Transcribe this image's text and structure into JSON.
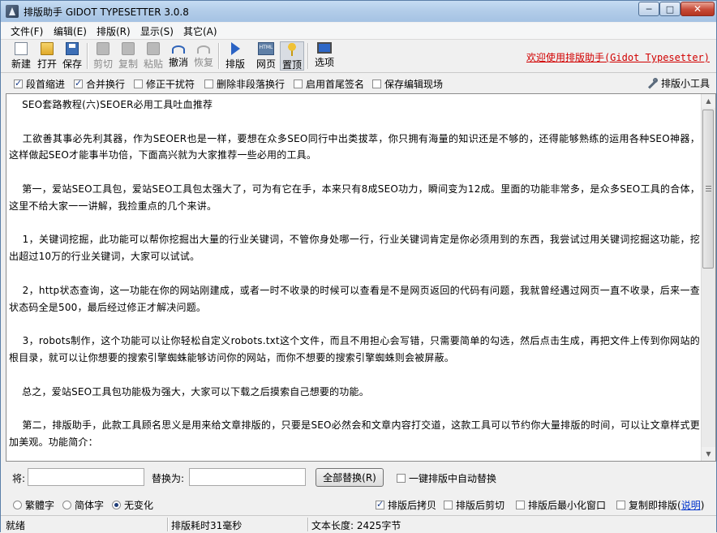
{
  "window": {
    "title": "排版助手 GIDOT TYPESETTER 3.0.8",
    "min_glyph": "─",
    "max_glyph": "□",
    "close_glyph": "✕"
  },
  "menu": [
    {
      "label": "文件(F)"
    },
    {
      "label": "编辑(E)"
    },
    {
      "label": "排版(R)"
    },
    {
      "label": "显示(S)"
    },
    {
      "label": "其它(A)"
    }
  ],
  "toolbar": {
    "new": "新建",
    "open": "打开",
    "save": "保存",
    "cut": "剪切",
    "copy": "复制",
    "paste": "粘贴",
    "undo": "撤消",
    "redo": "恢复",
    "typeset": "排版",
    "webpage": "网页",
    "top": "置顶",
    "options": "选项",
    "welcome": "欢迎使用排版助手(Gidot Typesetter)"
  },
  "options": {
    "indent": {
      "label": "段首缩进",
      "checked": true
    },
    "merge_lines": {
      "label": "合并换行",
      "checked": true
    },
    "fix_interference": {
      "label": "修正干扰符",
      "checked": false
    },
    "delete_nonpara": {
      "label": "删除非段落换行",
      "checked": false
    },
    "head_tail_sign": {
      "label": "启用首尾签名",
      "checked": false
    },
    "save_scene": {
      "label": "保存编辑现场",
      "checked": false
    },
    "tools": "排版小工具"
  },
  "editor": {
    "paragraphs": [
      "    SEO套路教程(六)SEOER必用工具吐血推荐",
      "",
      "    工欲善其事必先利其器，作为SEOER也是一样，要想在众多SEO同行中出类拔萃，你只拥有海量的知识还是不够的，还得能够熟练的运用各种SEO神器，这样做起SEO才能事半功倍，下面高兴就为大家推荐一些必用的工具。",
      "",
      "    第一，爱站SEO工具包，爱站SEO工具包太强大了，可为有它在手，本来只有8成SEO功力，瞬间变为12成。里面的功能非常多，是众多SEO工具的合体，这里不给大家一一讲解，我捡重点的几个来讲。",
      "",
      "    1，关键词挖掘，此功能可以帮你挖掘出大量的行业关键词，不管你身处哪一行，行业关键词肯定是你必须用到的东西，我尝试过用关键词挖掘这功能，挖出超过10万的行业关键词，大家可以试试。",
      "",
      "    2，http状态查询，这一功能在你的网站刚建成，或者一时不收录的时候可以查看是不是网页返回的代码有问题，我就曾经遇过网页一直不收录，后来一查状态码全是500，最后经过修正才解决问题。",
      "",
      "    3，robots制作，这个功能可以让你轻松自定义robots.txt这个文件，而且不用担心会写错，只需要简单的勾选，然后点击生成，再把文件上传到你网站的根目录，就可以让你想要的搜索引擎蜘蛛能够访问你的网站，而你不想要的搜索引擎蜘蛛则会被屏蔽。",
      "",
      "    总之，爱站SEO工具包功能极为强大，大家可以下载之后摸索自己想要的功能。",
      "",
      "    第二，排版助手，此款工具顾名思义是用来给文章排版的，只要是SEO必然会和文章内容打交道，这款工具可以节约你大量排版的时间，可以让文章样式更加美观。功能简介："
    ]
  },
  "replace": {
    "find_label": "将:",
    "find_value": "",
    "replace_label": "替换为:",
    "replace_value": "",
    "button": "全部替换(R)",
    "auto": {
      "label": "一键排版中自动替换",
      "checked": false
    }
  },
  "bottom": {
    "traditional": {
      "label": "繁體字",
      "selected": false
    },
    "simplified": {
      "label": "简体字",
      "selected": false
    },
    "nochange": {
      "label": "无变化",
      "selected": true
    },
    "copy_after": {
      "label": "排版后拷贝",
      "checked": true
    },
    "cut_after": {
      "label": "排版后剪切",
      "checked": false
    },
    "minimize_after": {
      "label": "排版后最小化窗口",
      "checked": false
    },
    "copy_is_typeset": {
      "label": "复制即排版(",
      "checked": false
    },
    "help_link": "说明",
    "close_paren": ")"
  },
  "status": {
    "ready": "就绪",
    "time": "排版耗时31毫秒",
    "length": "文本长度: 2425字节"
  }
}
